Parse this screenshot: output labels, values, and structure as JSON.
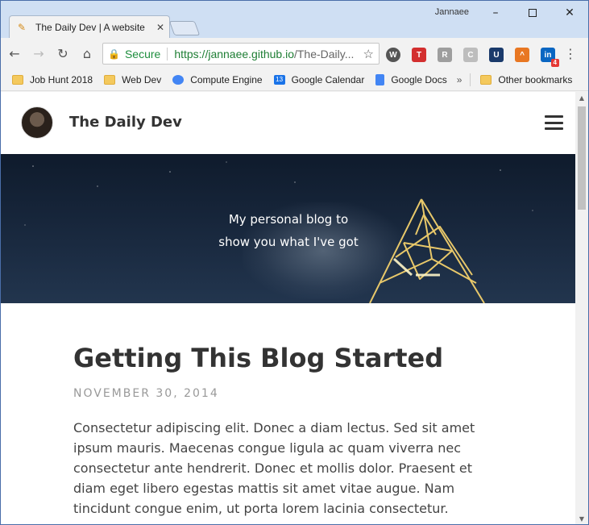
{
  "browser": {
    "user_name": "Jannaee",
    "tab": {
      "title": "The Daily Dev | A website",
      "favicon": "pencil-icon"
    },
    "window_controls": {
      "minimize": "minimize-icon",
      "maximize": "maximize-icon",
      "close": "close-icon"
    },
    "omnibox": {
      "secure_label": "Secure",
      "url_host": "https://jannaee.github.io",
      "url_path": "/The-Daily..."
    },
    "extensions": [
      {
        "name": "w-extension-icon",
        "label": "W",
        "color": "#555555"
      },
      {
        "name": "t-extension-icon",
        "label": "T",
        "color": "#d32f2f"
      },
      {
        "name": "r-extension-icon",
        "label": "R",
        "color": "#9e9e9e"
      },
      {
        "name": "c-extension-icon",
        "label": "C",
        "color": "#9e9e9e"
      },
      {
        "name": "u-extension-icon",
        "label": "U",
        "color": "#1a3a6b"
      },
      {
        "name": "arc-extension-icon",
        "label": "^",
        "color": "#e87722"
      },
      {
        "name": "linkedin-icon",
        "label": "in",
        "color": "#0a66c2",
        "badge": "4"
      }
    ],
    "bookmarks": [
      {
        "label": "Job Hunt 2018",
        "icon": "folder-icon"
      },
      {
        "label": "Web Dev",
        "icon": "folder-icon"
      },
      {
        "label": "Compute Engine",
        "icon": "chip-icon"
      },
      {
        "label": "Google Calendar",
        "icon": "calendar-icon",
        "icon_text": "13"
      },
      {
        "label": "Google Docs",
        "icon": "docs-icon"
      }
    ],
    "bookmarks_overflow": "»",
    "other_bookmarks": "Other bookmarks"
  },
  "site": {
    "title": "The Daily Dev",
    "hero": {
      "line1": "My personal blog to",
      "line2": "show you what I've got"
    },
    "post": {
      "title": "Getting This Blog Started",
      "date": "NOVEMBER 30, 2014",
      "body": "Consectetur adipiscing elit. Donec a diam lectus. Sed sit amet ipsum mauris. Maecenas congue ligula ac quam viverra nec consectetur ante hendrerit. Donec et mollis dolor. Praesent et diam eget libero egestas mattis sit amet vitae augue. Nam tincidunt congue enim, ut porta lorem lacinia consectetur."
    }
  },
  "colors": {
    "secure_green": "#1e8e3e",
    "hero_dark": "#0f1b2c",
    "text_dark": "#333333",
    "date_gray": "#999999"
  }
}
